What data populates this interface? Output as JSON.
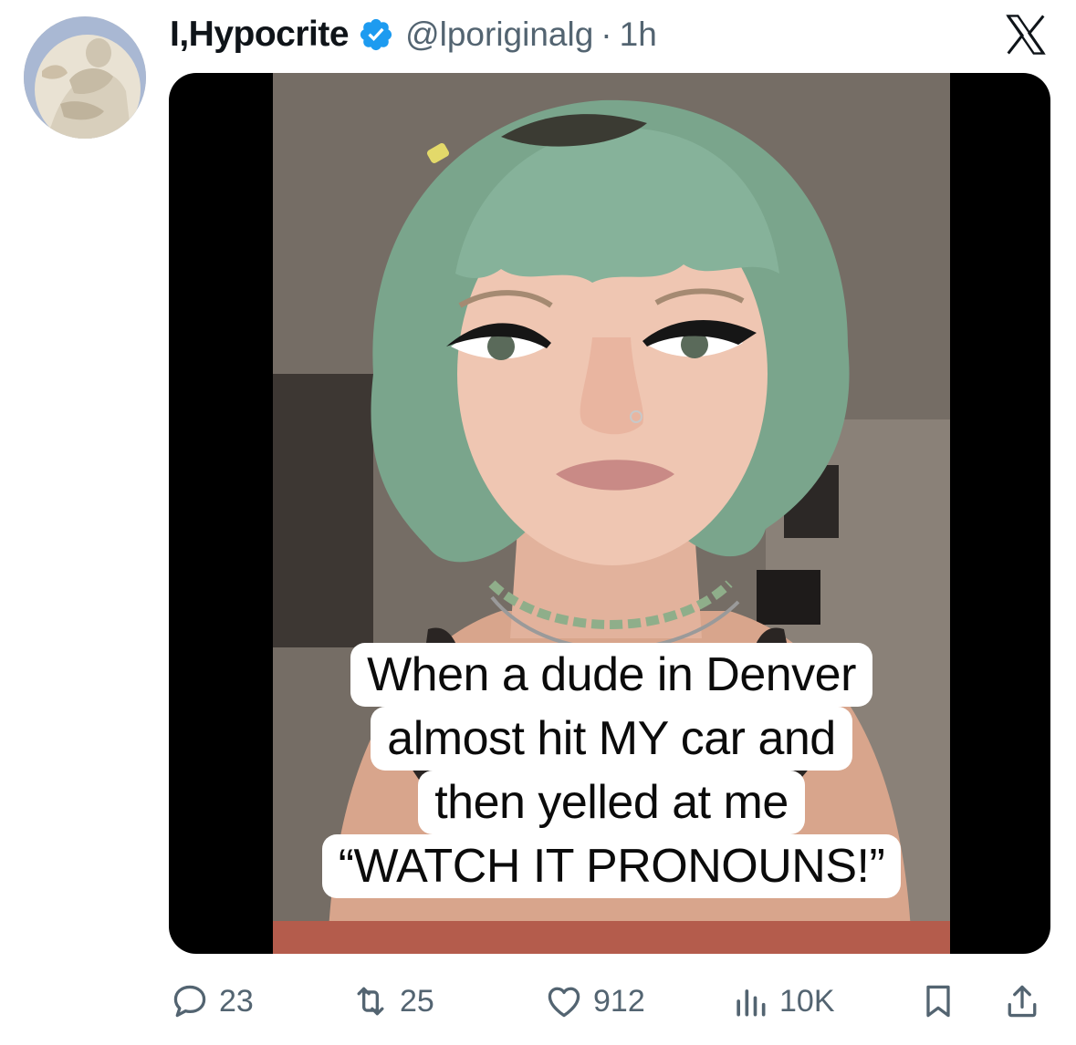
{
  "author": {
    "display_name": "I,Hypocrite",
    "handle": "@lporiginalg",
    "separator": "·",
    "time": "1h",
    "verified": true
  },
  "brand": {
    "logo": "x-logo-icon"
  },
  "media": {
    "caption_lines": [
      "When a dude in Denver",
      "almost hit MY car and",
      "then yelled at me",
      "“WATCH IT PRONOUNS!”"
    ]
  },
  "actions": {
    "replies": "23",
    "reposts": "25",
    "likes": "912",
    "views": "10K"
  },
  "icons": {
    "reply": "reply-bubble-icon",
    "repost": "repost-icon",
    "like": "heart-icon",
    "views": "bar-chart-icon",
    "bookmark": "bookmark-icon",
    "share": "share-upload-icon",
    "verified": "verified-badge-icon"
  },
  "colors": {
    "text_primary": "#0f1419",
    "text_secondary": "#536471",
    "verified_blue": "#1d9bf0"
  }
}
